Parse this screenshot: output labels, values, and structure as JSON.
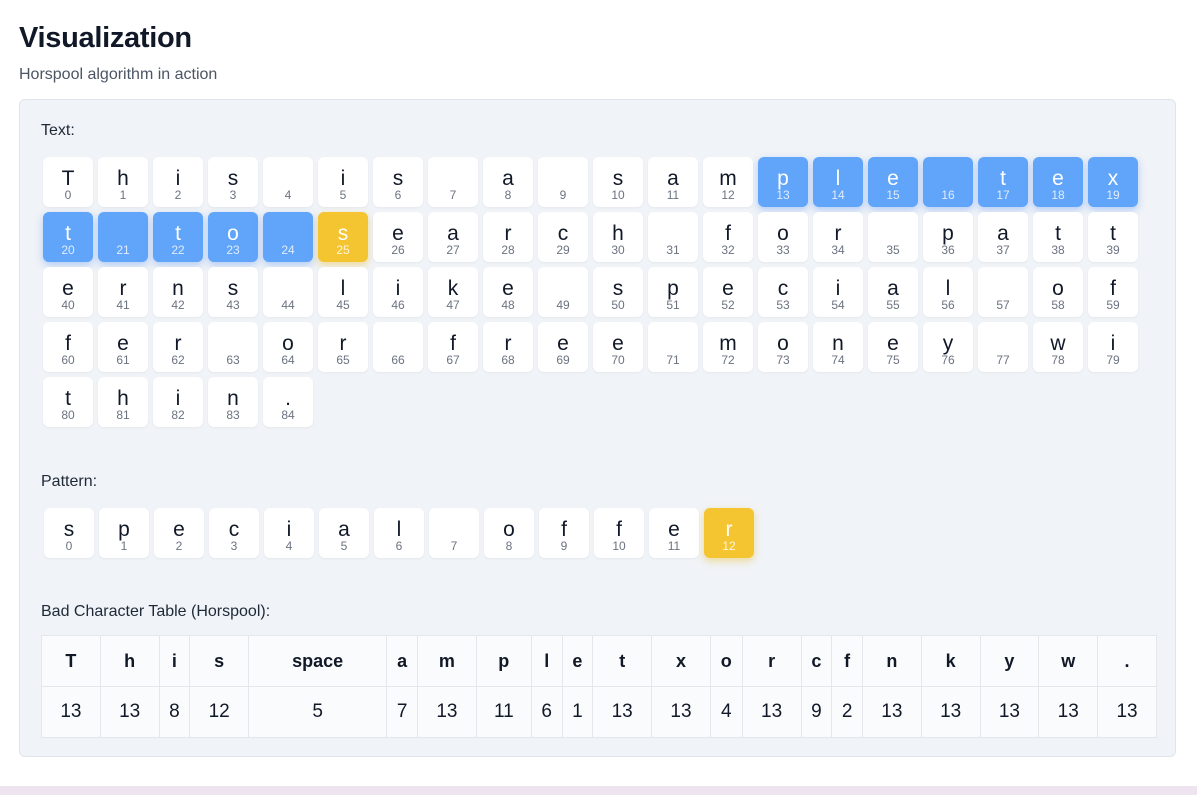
{
  "header": {
    "title": "Visualization",
    "subtitle": "Horspool algorithm in action"
  },
  "text_section": {
    "label": "Text:",
    "cells": [
      "T",
      "h",
      "i",
      "s",
      " ",
      "i",
      "s",
      " ",
      "a",
      " ",
      "s",
      "a",
      "m",
      "p",
      "l",
      "e",
      " ",
      "t",
      "e",
      "x",
      "t",
      " ",
      "t",
      "o",
      " ",
      "s",
      "e",
      "a",
      "r",
      "c",
      "h",
      " ",
      "f",
      "o",
      "r",
      " ",
      "p",
      "a",
      "t",
      "t",
      "e",
      "r",
      "n",
      "s",
      " ",
      "l",
      "i",
      "k",
      "e",
      " ",
      "s",
      "p",
      "e",
      "c",
      "i",
      "a",
      "l",
      " ",
      "o",
      "f",
      "f",
      "e",
      "r",
      " ",
      "o",
      "r",
      " ",
      "f",
      "r",
      "e",
      "e",
      " ",
      "m",
      "o",
      "n",
      "e",
      "y",
      " ",
      "w",
      "i",
      "t",
      "h",
      "i",
      "n",
      "."
    ],
    "window_indices": [
      13,
      14,
      15,
      16,
      17,
      18,
      19,
      20,
      21,
      22,
      23,
      24
    ],
    "compare_index": 25
  },
  "pattern_section": {
    "label": "Pattern:",
    "cells": [
      "s",
      "p",
      "e",
      "c",
      "i",
      "a",
      "l",
      " ",
      "o",
      "f",
      "f",
      "e",
      "r"
    ],
    "compare_index": 12
  },
  "bad_char_table": {
    "label": "Bad Character Table (Horspool):",
    "headers": [
      "T",
      "h",
      "i",
      "s",
      "space",
      "a",
      "m",
      "p",
      "l",
      "e",
      "t",
      "x",
      "o",
      "r",
      "c",
      "f",
      "n",
      "k",
      "y",
      "w",
      "."
    ],
    "values": [
      "13",
      "13",
      "8",
      "12",
      "5",
      "7",
      "13",
      "11",
      "6",
      "1",
      "13",
      "13",
      "4",
      "13",
      "9",
      "2",
      "13",
      "13",
      "13",
      "13",
      "13"
    ]
  },
  "colors": {
    "window_highlight": "#60a5fa",
    "compare_highlight": "#f5c431"
  }
}
